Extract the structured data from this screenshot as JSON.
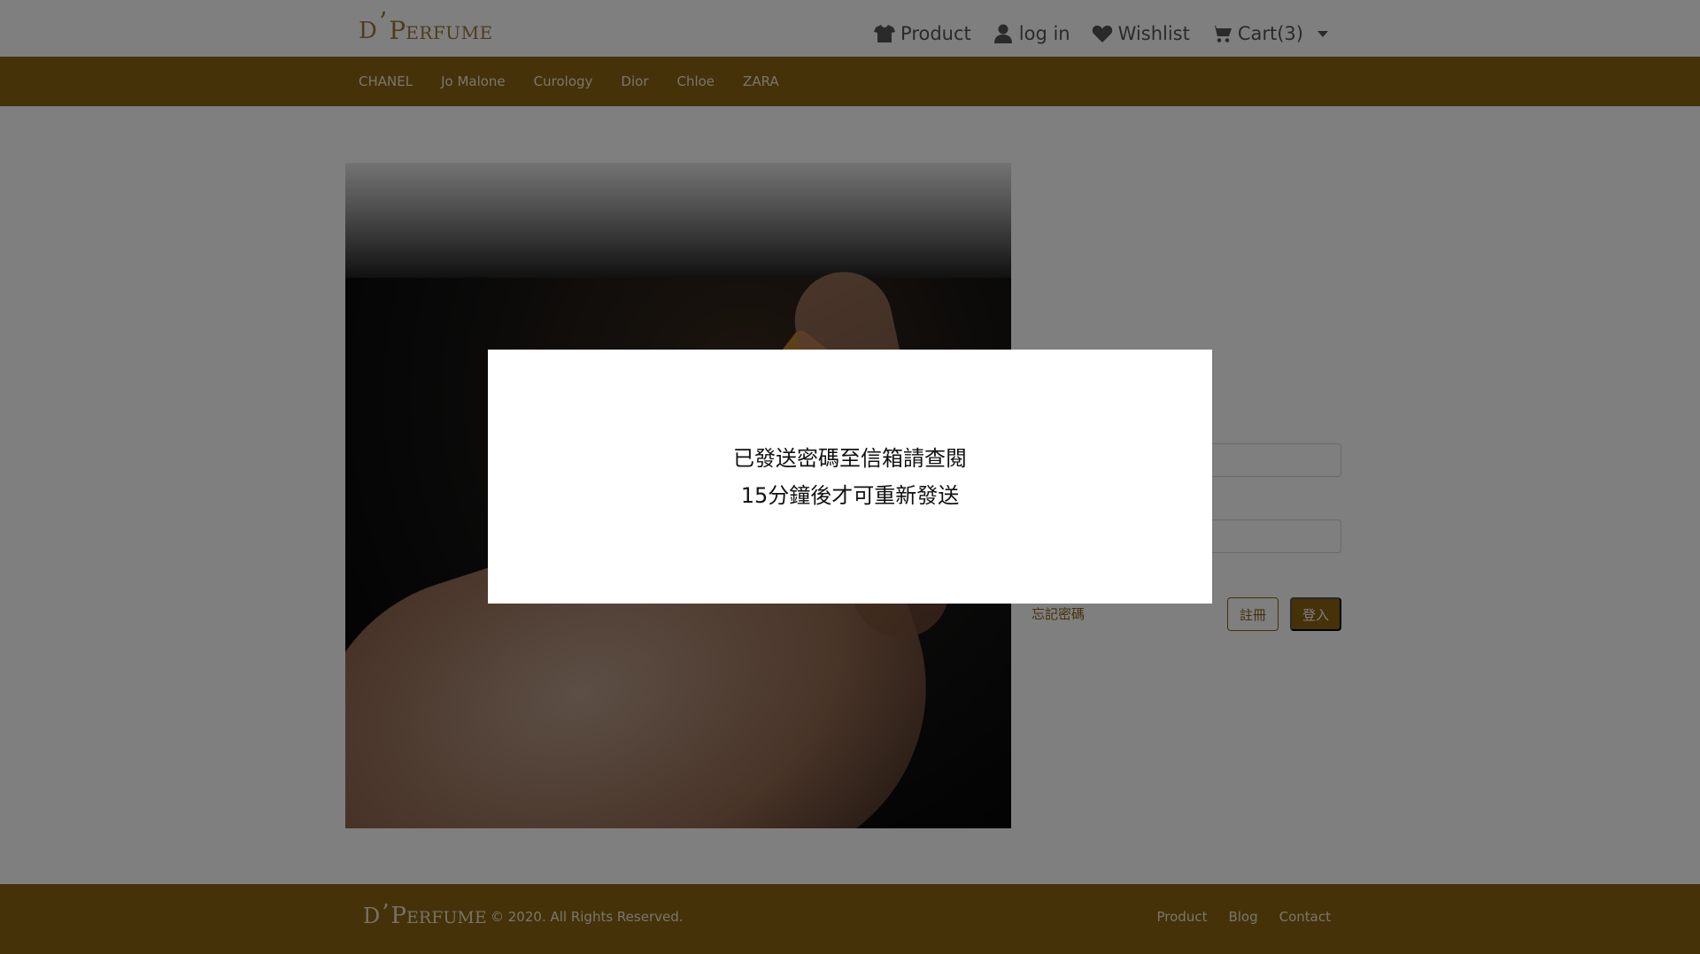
{
  "header": {
    "brand": {
      "d": "D",
      "apos": "’",
      "p": "P",
      "rest": "ERFUME"
    },
    "nav": [
      {
        "label": "Product",
        "icon": "shirt-icon"
      },
      {
        "label": "log in",
        "icon": "user-icon"
      },
      {
        "label": "Wishlist",
        "icon": "heart-icon"
      },
      {
        "label": "Cart(3)",
        "icon": "cart-icon"
      }
    ]
  },
  "categories": [
    "CHANEL",
    "Jo Malone",
    "Curology",
    "Dior",
    "Chloe",
    "ZARA"
  ],
  "login": {
    "forgot_label": "忘記密碼",
    "register_label": "註冊",
    "login_label": "登入"
  },
  "modal": {
    "line1": "已發送密碼至信箱請查閱",
    "line2": "15分鐘後才可重新發送"
  },
  "footer": {
    "brand": {
      "d": "D",
      "apos": "’",
      "p": "P",
      "rest": "ERFUME"
    },
    "copyright": "© 2020. All Rights Reserved.",
    "links": [
      "Product",
      "Blog",
      "Contact"
    ]
  },
  "colors": {
    "brand_brown": "#8a6412",
    "gold": "#9a7a36"
  }
}
